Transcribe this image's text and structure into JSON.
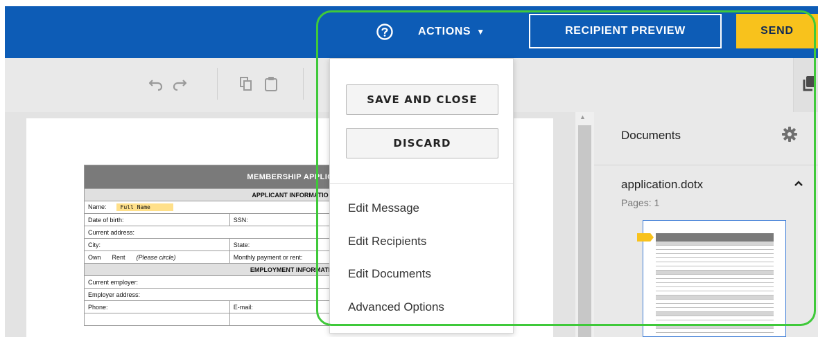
{
  "header": {
    "help_icon": "help-circle-icon",
    "actions_label": "ACTIONS",
    "actions_caret": "▼",
    "recipient_preview_label": "RECIPIENT PREVIEW",
    "send_label": "SEND"
  },
  "toolbar": {
    "icons": [
      "undo-icon",
      "redo-icon",
      "copy-icon",
      "paste-icon"
    ]
  },
  "actions_menu": {
    "save_and_close": "SAVE AND CLOSE",
    "discard": "DISCARD",
    "items": [
      "Edit Message",
      "Edit Recipients",
      "Edit Documents",
      "Advanced Options"
    ]
  },
  "document": {
    "title": "MEMBERSHIP APPLIC",
    "applicant_header": "APPLICANT INFORMATIO",
    "name_label": "Name:",
    "full_name_field": "Full Name",
    "dob_label": "Date of birth:",
    "ssn_label": "SSN:",
    "current_address_label": "Current address:",
    "city_label": "City:",
    "state_label": "State:",
    "own_label": "Own",
    "rent_label": "Rent",
    "please_circle": "(Please circle)",
    "monthly_payment_label": "Monthly payment or rent:",
    "employment_header": "EMPLOYMENT INFORMATI",
    "current_employer_label": "Current employer:",
    "employer_address_label": "Employer address:",
    "phone_label": "Phone:",
    "email_label": "E-mail:"
  },
  "right_panel": {
    "documents_label": "Documents",
    "file_name": "application.dotx",
    "pages_label": "Pages: 1"
  },
  "colors": {
    "topbar": "#0d5cb6",
    "send": "#f8c21c",
    "highlight": "#3fc93a"
  }
}
